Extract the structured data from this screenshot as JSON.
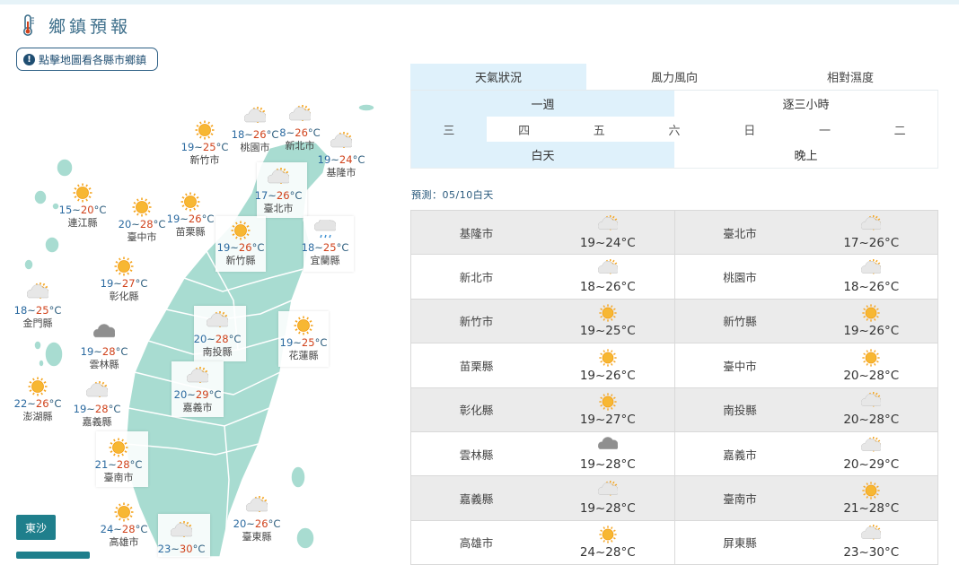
{
  "page": {
    "title": "鄉鎮預報",
    "hint": "點擊地圖看各縣市鄉鎮",
    "hint_icon": "info-icon"
  },
  "tabs": [
    "天氣狀況",
    "風力風向",
    "相對濕度"
  ],
  "mode": {
    "week": "一週",
    "hourly": "逐三小時"
  },
  "days": [
    "三",
    "四",
    "五",
    "六",
    "日",
    "一",
    "二"
  ],
  "period": {
    "day": "白天",
    "night": "晚上"
  },
  "forecast_label": "預測：05/10白天",
  "map_labels": [
    {
      "name": "新竹市",
      "temp": "19~25°C",
      "icon": "sunny-icon"
    },
    {
      "name": "桃園市",
      "temp": "18~26°C",
      "icon": "partly-cloudy-icon"
    },
    {
      "name": "新北市",
      "temp": "8~26°C",
      "icon": "partly-cloudy-icon"
    },
    {
      "name": "基隆市",
      "temp": "19~24°C",
      "icon": "partly-cloudy-icon"
    },
    {
      "name": "臺北市",
      "temp": "17~26°C",
      "icon": "partly-cloudy-icon"
    },
    {
      "name": "連江縣",
      "temp": "15~20°C",
      "icon": "sunny-icon"
    },
    {
      "name": "臺中市",
      "temp": "20~28°C",
      "icon": "sunny-icon"
    },
    {
      "name": "苗栗縣",
      "temp": "19~26°C",
      "icon": "sunny-icon"
    },
    {
      "name": "新竹縣",
      "temp": "19~26°C",
      "icon": "sunny-icon"
    },
    {
      "name": "宜蘭縣",
      "temp": "18~25°C",
      "icon": "rain-icon"
    },
    {
      "name": "彰化縣",
      "temp": "19~27°C",
      "icon": "sunny-icon"
    },
    {
      "name": "金門縣",
      "temp": "18~25°C",
      "icon": "partly-cloudy-icon"
    },
    {
      "name": "南投縣",
      "temp": "20~28°C",
      "icon": "partly-cloudy-icon"
    },
    {
      "name": "花蓮縣",
      "temp": "19~25°C",
      "icon": "sunny-icon"
    },
    {
      "name": "雲林縣",
      "temp": "19~28°C",
      "icon": "cloudy-icon"
    },
    {
      "name": "嘉義市",
      "temp": "20~29°C",
      "icon": "partly-cloudy-icon"
    },
    {
      "name": "澎湖縣",
      "temp": "22~26°C",
      "icon": "sunny-icon"
    },
    {
      "name": "嘉義縣",
      "temp": "19~28°C",
      "icon": "partly-cloudy-icon"
    },
    {
      "name": "臺南市",
      "temp": "21~28°C",
      "icon": "sunny-icon"
    },
    {
      "name": "高雄市",
      "temp": "24~28°C",
      "icon": "sunny-icon"
    },
    {
      "name": "臺東縣",
      "temp": "20~26°C",
      "icon": "partly-cloudy-icon"
    },
    {
      "name": "",
      "temp": "23~30°C",
      "icon": "partly-cloudy-icon"
    }
  ],
  "buttons": {
    "dongsha": "東沙"
  },
  "table": [
    [
      {
        "name": "基隆市",
        "temp": "19~24°C",
        "icon": "partly-cloudy-icon"
      },
      {
        "name": "臺北市",
        "temp": "17~26°C",
        "icon": "partly-cloudy-icon"
      }
    ],
    [
      {
        "name": "新北市",
        "temp": "18~26°C",
        "icon": "partly-cloudy-icon"
      },
      {
        "name": "桃園市",
        "temp": "18~26°C",
        "icon": "partly-cloudy-icon"
      }
    ],
    [
      {
        "name": "新竹市",
        "temp": "19~25°C",
        "icon": "sunny-icon"
      },
      {
        "name": "新竹縣",
        "temp": "19~26°C",
        "icon": "sunny-icon"
      }
    ],
    [
      {
        "name": "苗栗縣",
        "temp": "19~26°C",
        "icon": "sunny-icon"
      },
      {
        "name": "臺中市",
        "temp": "20~28°C",
        "icon": "sunny-icon"
      }
    ],
    [
      {
        "name": "彰化縣",
        "temp": "19~27°C",
        "icon": "sunny-icon"
      },
      {
        "name": "南投縣",
        "temp": "20~28°C",
        "icon": "partly-cloudy-icon"
      }
    ],
    [
      {
        "name": "雲林縣",
        "temp": "19~28°C",
        "icon": "cloudy-icon"
      },
      {
        "name": "嘉義市",
        "temp": "20~29°C",
        "icon": "partly-cloudy-icon"
      }
    ],
    [
      {
        "name": "嘉義縣",
        "temp": "19~28°C",
        "icon": "partly-cloudy-icon"
      },
      {
        "name": "臺南市",
        "temp": "21~28°C",
        "icon": "sunny-icon"
      }
    ],
    [
      {
        "name": "高雄市",
        "temp": "24~28°C",
        "icon": "sunny-icon"
      },
      {
        "name": "屏東縣",
        "temp": "23~30°C",
        "icon": "partly-cloudy-icon"
      }
    ]
  ],
  "colors": {
    "map_land": "#a8dcd1",
    "accent": "#dff1fb",
    "button": "#1f7f8c",
    "title": "#3c6e8a",
    "low_temp": "#2b6aa0",
    "high_temp": "#d0421b"
  }
}
